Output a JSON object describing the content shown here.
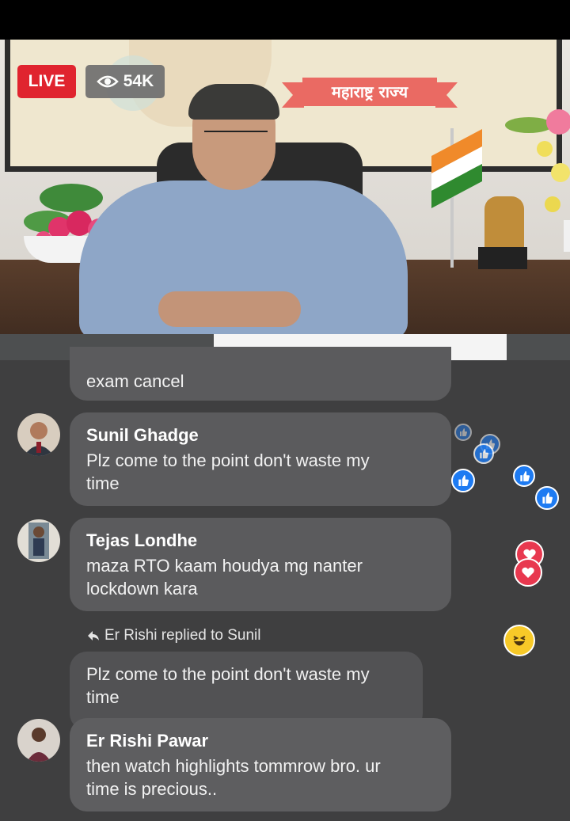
{
  "stream": {
    "live_label": "LIVE",
    "viewer_count": "54K",
    "banner_text": "महाराष्ट्र राज्य"
  },
  "comments": [
    {
      "text": "exam cancel"
    },
    {
      "name": "Sunil Ghadge",
      "text_line1": "Plz come to the point don't waste my",
      "text_line2": "time"
    },
    {
      "name": "Tejas Londhe",
      "text_line1": "maza RTO kaam houdya mg nanter",
      "text_line2": "lockdown kara"
    },
    {
      "reply_note": "Er Rishi replied to Sunil",
      "quoted_line1": "Plz come to the point don't waste my",
      "quoted_line2": "time"
    },
    {
      "name": "Er Rishi Pawar",
      "text_line1": "then watch highlights tommrow bro. ur",
      "text_line2": "time is precious.."
    }
  ],
  "colors": {
    "live_red": "#e0242f",
    "bubble_bg": "#5b5b5d",
    "like_blue": "#1e7bf2",
    "love_red": "#e8384f",
    "haha_yellow": "#f7c928"
  },
  "icons": [
    "eye-icon",
    "reply-arrow-icon",
    "like-reaction-icon",
    "love-reaction-icon",
    "haha-reaction-icon"
  ]
}
